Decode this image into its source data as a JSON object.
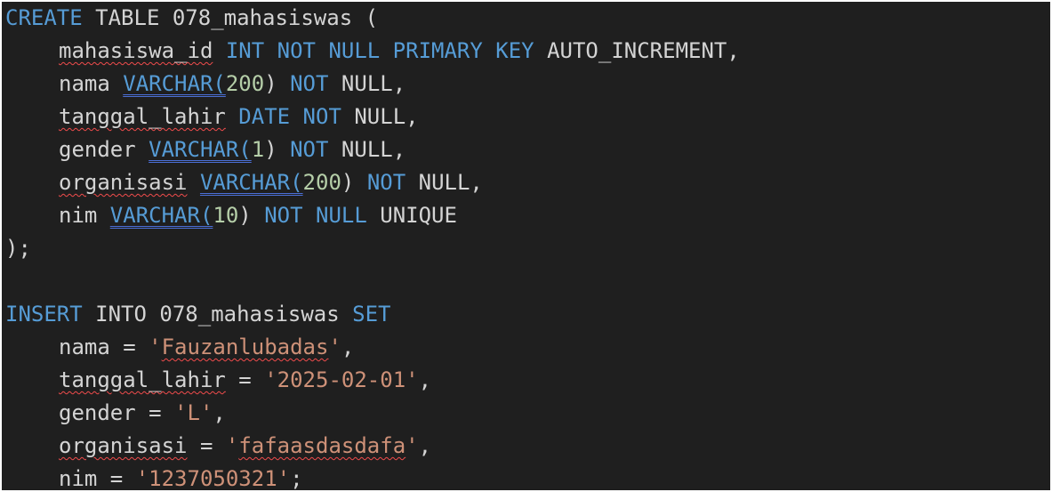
{
  "editor": {
    "theme": {
      "background": "#1f1f1f",
      "keyword": "#569cd6",
      "text": "#d4d4d4",
      "number": "#b5cea8",
      "string": "#ce9178",
      "error_squiggle": "#f14c4c",
      "info_underline": "#4b6fd6"
    },
    "lines": [
      {
        "tokens": [
          {
            "t": "CREATE",
            "c": "kw"
          },
          {
            "t": " TABLE 078_mahasiswas (",
            "c": "plain"
          }
        ]
      },
      {
        "indent": true,
        "tokens": [
          {
            "t": "mahasiswa_id",
            "c": "plain",
            "u": "squiggle"
          },
          {
            "t": " ",
            "c": "plain"
          },
          {
            "t": "INT NOT NULL PRIMARY KEY",
            "c": "kw"
          },
          {
            "t": " AUTO_INCREMENT,",
            "c": "plain"
          }
        ]
      },
      {
        "indent": true,
        "tokens": [
          {
            "t": "nama ",
            "c": "plain"
          },
          {
            "t": "VARCHAR(",
            "c": "kw",
            "u": "dbl"
          },
          {
            "t": "200",
            "c": "num"
          },
          {
            "t": ") ",
            "c": "plain"
          },
          {
            "t": "NOT",
            "c": "kw"
          },
          {
            "t": " NULL,",
            "c": "plain"
          }
        ]
      },
      {
        "indent": true,
        "tokens": [
          {
            "t": "tanggal_lahir",
            "c": "plain",
            "u": "squiggle"
          },
          {
            "t": " ",
            "c": "plain"
          },
          {
            "t": "DATE NOT",
            "c": "kw"
          },
          {
            "t": " NULL,",
            "c": "plain"
          }
        ]
      },
      {
        "indent": true,
        "tokens": [
          {
            "t": "gender ",
            "c": "plain"
          },
          {
            "t": "VARCHAR(",
            "c": "kw",
            "u": "dbl"
          },
          {
            "t": "1",
            "c": "num"
          },
          {
            "t": ") ",
            "c": "plain"
          },
          {
            "t": "NOT",
            "c": "kw"
          },
          {
            "t": " NULL,",
            "c": "plain"
          }
        ]
      },
      {
        "indent": true,
        "tokens": [
          {
            "t": "organisasi",
            "c": "plain",
            "u": "squiggle"
          },
          {
            "t": " ",
            "c": "plain"
          },
          {
            "t": "VARCHAR(",
            "c": "kw",
            "u": "dbl"
          },
          {
            "t": "200",
            "c": "num"
          },
          {
            "t": ") ",
            "c": "plain"
          },
          {
            "t": "NOT",
            "c": "kw"
          },
          {
            "t": " NULL,",
            "c": "plain"
          }
        ]
      },
      {
        "indent": true,
        "tokens": [
          {
            "t": "nim ",
            "c": "plain"
          },
          {
            "t": "VARCHAR(",
            "c": "kw",
            "u": "dbl"
          },
          {
            "t": "10",
            "c": "num"
          },
          {
            "t": ") ",
            "c": "plain"
          },
          {
            "t": "NOT NULL",
            "c": "kw"
          },
          {
            "t": " UNIQUE",
            "c": "plain"
          }
        ]
      },
      {
        "tokens": [
          {
            "t": ");",
            "c": "plain"
          }
        ]
      },
      {
        "tokens": []
      },
      {
        "tokens": [
          {
            "t": "INSERT",
            "c": "kw"
          },
          {
            "t": " INTO 078_mahasiswas ",
            "c": "plain"
          },
          {
            "t": "SET",
            "c": "kw"
          }
        ]
      },
      {
        "indent": true,
        "tokens": [
          {
            "t": "nama = ",
            "c": "plain"
          },
          {
            "t": "'",
            "c": "str"
          },
          {
            "t": "Fauzanlubadas",
            "c": "str",
            "u": "squiggle"
          },
          {
            "t": "'",
            "c": "str"
          },
          {
            "t": ",",
            "c": "plain"
          }
        ]
      },
      {
        "indent": true,
        "tokens": [
          {
            "t": "tanggal_lahir",
            "c": "plain",
            "u": "squiggle"
          },
          {
            "t": " = ",
            "c": "plain"
          },
          {
            "t": "'2025-02-01'",
            "c": "str"
          },
          {
            "t": ",",
            "c": "plain"
          }
        ]
      },
      {
        "indent": true,
        "tokens": [
          {
            "t": "gender = ",
            "c": "plain"
          },
          {
            "t": "'L'",
            "c": "str"
          },
          {
            "t": ",",
            "c": "plain"
          }
        ]
      },
      {
        "indent": true,
        "tokens": [
          {
            "t": "organisasi",
            "c": "plain",
            "u": "squiggle"
          },
          {
            "t": " = ",
            "c": "plain"
          },
          {
            "t": "'",
            "c": "str"
          },
          {
            "t": "fafaasdasdafa",
            "c": "str",
            "u": "squiggle"
          },
          {
            "t": "'",
            "c": "str"
          },
          {
            "t": ",",
            "c": "plain"
          }
        ]
      },
      {
        "indent": true,
        "tokens": [
          {
            "t": "nim = ",
            "c": "plain"
          },
          {
            "t": "'1237050321'",
            "c": "str"
          },
          {
            "t": ";",
            "c": "plain"
          }
        ]
      }
    ]
  }
}
